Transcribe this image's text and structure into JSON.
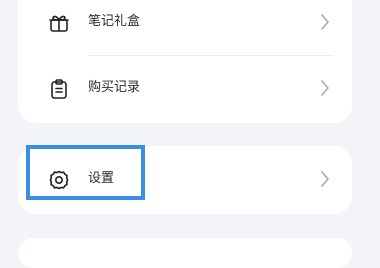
{
  "menu": {
    "group1": [
      {
        "label": "笔记礼盒",
        "icon": "gift-box-icon"
      },
      {
        "label": "购买记录",
        "icon": "clipboard-record-icon"
      }
    ],
    "group2": [
      {
        "label": "设置",
        "icon": "gear-icon"
      }
    ]
  },
  "colors": {
    "background": "#f3f4f8",
    "card": "#ffffff",
    "highlight_border": "#3a8ee6"
  }
}
